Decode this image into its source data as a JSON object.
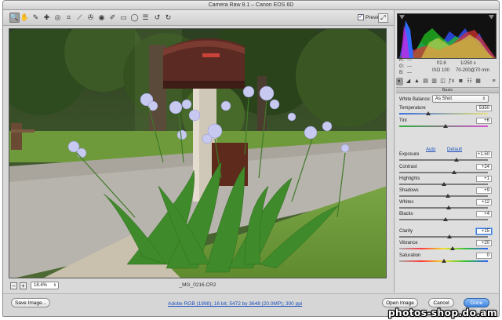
{
  "window": {
    "title": "Camera Raw 8.1  –  Canon EOS 6D"
  },
  "toolbar": {
    "tools": [
      {
        "name": "zoom-tool",
        "glyph": "🔍"
      },
      {
        "name": "hand-tool",
        "glyph": "✋"
      },
      {
        "name": "white-balance-tool",
        "glyph": "✎"
      },
      {
        "name": "color-sampler-tool",
        "glyph": "✚"
      },
      {
        "name": "targeted-adjustment-tool",
        "glyph": "◎"
      },
      {
        "name": "crop-tool",
        "glyph": "⌗"
      },
      {
        "name": "straighten-tool",
        "glyph": "⟋"
      },
      {
        "name": "spot-removal-tool",
        "glyph": "✇"
      },
      {
        "name": "red-eye-tool",
        "glyph": "◉"
      },
      {
        "name": "adjustment-brush-tool",
        "glyph": "✐"
      },
      {
        "name": "graduated-filter-tool",
        "glyph": "▭"
      },
      {
        "name": "radial-filter-tool",
        "glyph": "◯"
      },
      {
        "name": "preferences-tool",
        "glyph": "☰"
      },
      {
        "name": "rotate-ccw-tool",
        "glyph": "↺"
      },
      {
        "name": "rotate-cw-tool",
        "glyph": "↻"
      }
    ],
    "preview_label": "Preview",
    "preview_checked": "✓"
  },
  "image": {
    "filename": "_MG_0216.CR2"
  },
  "zoom": {
    "minus": "–",
    "plus": "+",
    "level": "18.4%"
  },
  "camera_readout": {
    "r_label": "R:",
    "g_label": "G:",
    "b_label": "B:",
    "r_value": "---",
    "g_value": "---",
    "b_value": "---",
    "aperture": "f/2.8",
    "shutter": "1/250 s",
    "iso": "ISO 100",
    "lens": "70-200@70 mm"
  },
  "panel": {
    "header": "Basic",
    "white_balance_label": "White Balance:",
    "white_balance_value": "As Shot",
    "auto_label": "Auto",
    "default_label": "Default"
  },
  "sliders": [
    {
      "label": "Temperature",
      "value": "5350",
      "level": 0.33,
      "track": "temp"
    },
    {
      "label": "Tint",
      "value": "+6",
      "level": 0.52,
      "track": "tint"
    },
    {
      "label": "Exposure",
      "value": "+1.50",
      "level": 0.65,
      "track": "plain"
    },
    {
      "label": "Contrast",
      "value": "+24",
      "level": 0.62,
      "track": "plain"
    },
    {
      "label": "Highlights",
      "value": "+1",
      "level": 0.5,
      "track": "plain"
    },
    {
      "label": "Shadows",
      "value": "+9",
      "level": 0.55,
      "track": "plain"
    },
    {
      "label": "Whites",
      "value": "+12",
      "level": 0.56,
      "track": "plain"
    },
    {
      "label": "Blacks",
      "value": "+4",
      "level": 0.52,
      "track": "plain"
    },
    {
      "label": "Clarity",
      "value": "+15",
      "level": 0.57,
      "track": "plain"
    },
    {
      "label": "Vibrance",
      "value": "+20",
      "level": 0.6,
      "track": "sat"
    },
    {
      "label": "Saturation",
      "value": "0",
      "level": 0.5,
      "track": "sat"
    }
  ],
  "bottom": {
    "save_label": "Save Image...",
    "workflow_link": "Adobe RGB (1998); 16 bit; 5472 by 3648 (20.0MP); 300 ppi",
    "open_label": "Open Image",
    "cancel_label": "Cancel",
    "done_label": "Done"
  },
  "watermark": "photos-shop.do.am",
  "colors": {
    "accent": "#3f86e0",
    "link": "#1b4fbf"
  }
}
